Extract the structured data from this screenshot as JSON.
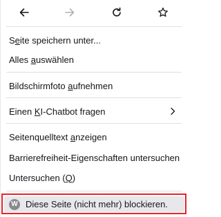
{
  "nav": {
    "back_icon": "arrow-left-icon",
    "forward_icon": "arrow-right-icon",
    "reload_icon": "reload-icon",
    "bookmark_icon": "star-icon"
  },
  "menu": {
    "save_page": {
      "pre": "S",
      "u": "e",
      "post": "ite speichern unter..."
    },
    "select_all": {
      "pre": "Alles ",
      "u": "a",
      "post": "uswählen"
    },
    "screenshot": {
      "pre": "Bildschirmfoto ",
      "u": "a",
      "post": "ufnehmen"
    },
    "ai_chatbot": {
      "pre": "Einen ",
      "u": "K",
      "post": "I-Chatbot fragen"
    },
    "view_source": {
      "pre": "Seitenquelltext ",
      "u": "a",
      "post": "nzeigen"
    },
    "accessibility": {
      "label": "Barrierefreiheit-Eigenschaften untersuchen"
    },
    "inspect": {
      "pre": "Untersuchen (",
      "u": "Q",
      "post": ")"
    },
    "block_page": {
      "icon_letter": "W",
      "label": "Diese Seite (nicht mehr) blockieren."
    }
  },
  "colors": {
    "highlight_border": "#e3242b",
    "hover_bg": "#e8e8ec",
    "text": "#15141a",
    "disabled": "#b0b0b5"
  }
}
